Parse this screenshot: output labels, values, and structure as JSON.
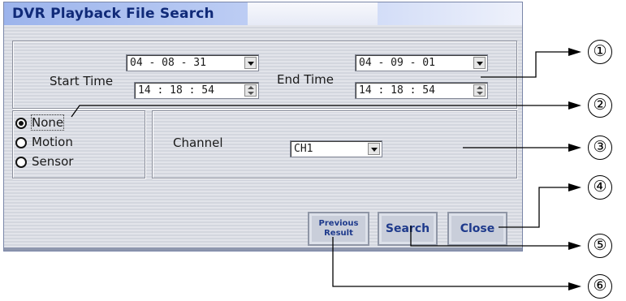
{
  "dialog": {
    "title": "DVR Playback File Search",
    "start_time_label": "Start Time",
    "end_time_label": "End Time",
    "start_date": "04 - 08 - 31",
    "start_time": "14 : 18 : 54",
    "end_date": "04 - 09 - 01",
    "end_time": "14 : 18 : 54",
    "radio_options": [
      {
        "label": "None",
        "selected": true
      },
      {
        "label": "Motion",
        "selected": false
      },
      {
        "label": "Sensor",
        "selected": false
      }
    ],
    "channel_label": "Channel",
    "channel_value": "CH1",
    "buttons": {
      "previous_line1": "Previous",
      "previous_line2": "Result",
      "search": "Search",
      "close": "Close"
    }
  },
  "callout_numbers": [
    "①",
    "②",
    "③",
    "④",
    "⑤",
    "⑥"
  ],
  "colors": {
    "title_text": "#102a78",
    "button_text": "#1e3a8c",
    "callout_line": "#000000"
  }
}
